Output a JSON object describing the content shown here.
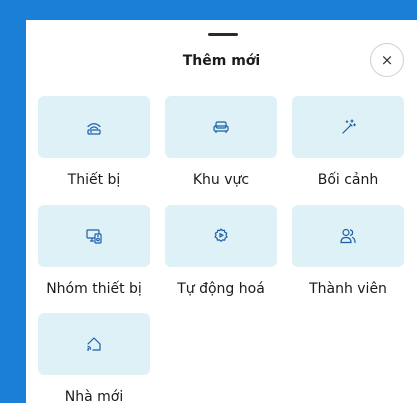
{
  "sheet": {
    "title": "Thêm mới",
    "close_label": "×"
  },
  "items": [
    {
      "label": "Thiết bị",
      "icon": "router-icon"
    },
    {
      "label": "Khu vực",
      "icon": "sofa-icon"
    },
    {
      "label": "Bối cảnh",
      "icon": "magic-wand-icon"
    },
    {
      "label": "Nhóm thiết bị",
      "icon": "device-group-icon"
    },
    {
      "label": "Tự động hoá",
      "icon": "automation-gear-icon"
    },
    {
      "label": "Thành viên",
      "icon": "members-icon"
    },
    {
      "label": "Nhà mới",
      "icon": "new-home-icon"
    }
  ],
  "colors": {
    "accent": "#1a7fd6",
    "tile_bg": "#def1f6",
    "icon": "#1b5fa8"
  }
}
